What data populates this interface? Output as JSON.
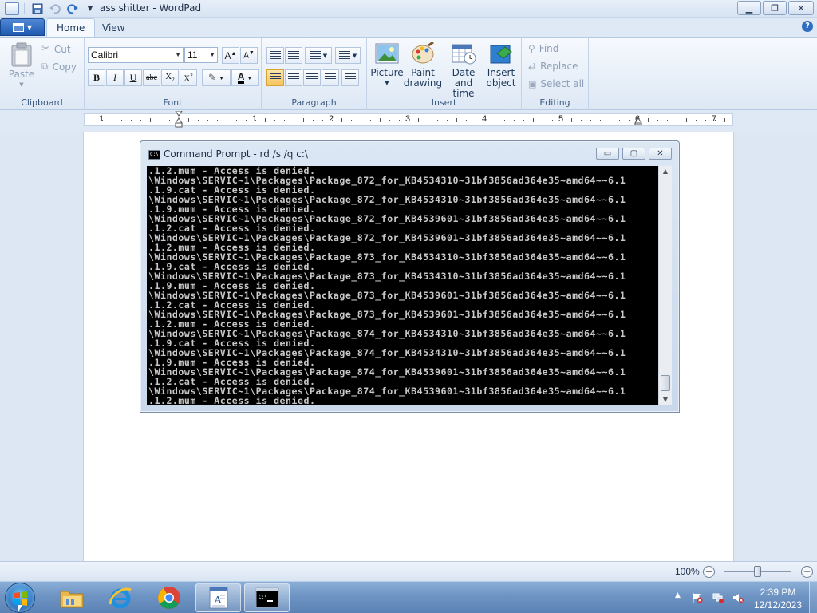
{
  "window": {
    "title": "ass shitter - WordPad"
  },
  "tabs": [
    "Home",
    "View"
  ],
  "ribbon": {
    "clipboard": {
      "label": "Clipboard",
      "paste": "Paste",
      "cut": "Cut",
      "copy": "Copy"
    },
    "font": {
      "label": "Font",
      "family": "Calibri",
      "size": "11"
    },
    "paragraph": {
      "label": "Paragraph"
    },
    "insert": {
      "label": "Insert",
      "picture": "Picture",
      "paint_line1": "Paint",
      "paint_line2": "drawing",
      "datetime_line1": "Date and",
      "datetime_line2": "time",
      "object_line1": "Insert",
      "object_line2": "object"
    },
    "editing": {
      "label": "Editing",
      "find": "Find",
      "replace": "Replace",
      "select_all": "Select all"
    }
  },
  "ruler": {
    "numbers": [
      "1",
      "1",
      "2",
      "3",
      "4",
      "5",
      "6",
      "7"
    ]
  },
  "cmd": {
    "title": "Command Prompt - rd  /s /q c:\\",
    "icon_text": "C:\\",
    "lines": [
      ".1.2.mum - Access is denied.",
      "\\Windows\\SERVIC~1\\Packages\\Package_872_for_KB4534310~31bf3856ad364e35~amd64~~6.1",
      ".1.9.cat - Access is denied.",
      "\\Windows\\SERVIC~1\\Packages\\Package_872_for_KB4534310~31bf3856ad364e35~amd64~~6.1",
      ".1.9.mum - Access is denied.",
      "\\Windows\\SERVIC~1\\Packages\\Package_872_for_KB4539601~31bf3856ad364e35~amd64~~6.1",
      ".1.2.cat - Access is denied.",
      "\\Windows\\SERVIC~1\\Packages\\Package_872_for_KB4539601~31bf3856ad364e35~amd64~~6.1",
      ".1.2.mum - Access is denied.",
      "\\Windows\\SERVIC~1\\Packages\\Package_873_for_KB4534310~31bf3856ad364e35~amd64~~6.1",
      ".1.9.cat - Access is denied.",
      "\\Windows\\SERVIC~1\\Packages\\Package_873_for_KB4534310~31bf3856ad364e35~amd64~~6.1",
      ".1.9.mum - Access is denied.",
      "\\Windows\\SERVIC~1\\Packages\\Package_873_for_KB4539601~31bf3856ad364e35~amd64~~6.1",
      ".1.2.cat - Access is denied.",
      "\\Windows\\SERVIC~1\\Packages\\Package_873_for_KB4539601~31bf3856ad364e35~amd64~~6.1",
      ".1.2.mum - Access is denied.",
      "\\Windows\\SERVIC~1\\Packages\\Package_874_for_KB4534310~31bf3856ad364e35~amd64~~6.1",
      ".1.9.cat - Access is denied.",
      "\\Windows\\SERVIC~1\\Packages\\Package_874_for_KB4534310~31bf3856ad364e35~amd64~~6.1",
      ".1.9.mum - Access is denied.",
      "\\Windows\\SERVIC~1\\Packages\\Package_874_for_KB4539601~31bf3856ad364e35~amd64~~6.1",
      ".1.2.cat - Access is denied.",
      "\\Windows\\SERVIC~1\\Packages\\Package_874_for_KB4539601~31bf3856ad364e35~amd64~~6.1",
      ".1.2.mum - Access is denied."
    ]
  },
  "status": {
    "zoom": "100%"
  },
  "taskbar": {
    "pinned": [
      "windows-explorer-icon",
      "internet-explorer-icon",
      "chrome-icon",
      "wordpad-icon",
      "command-prompt-icon"
    ],
    "clock_time": "2:39 PM",
    "clock_date": "12/12/2023"
  },
  "colors": {
    "console_bg": "#000000",
    "console_text": "#c8c8c8",
    "ribbon_active": "#f6c35b"
  }
}
